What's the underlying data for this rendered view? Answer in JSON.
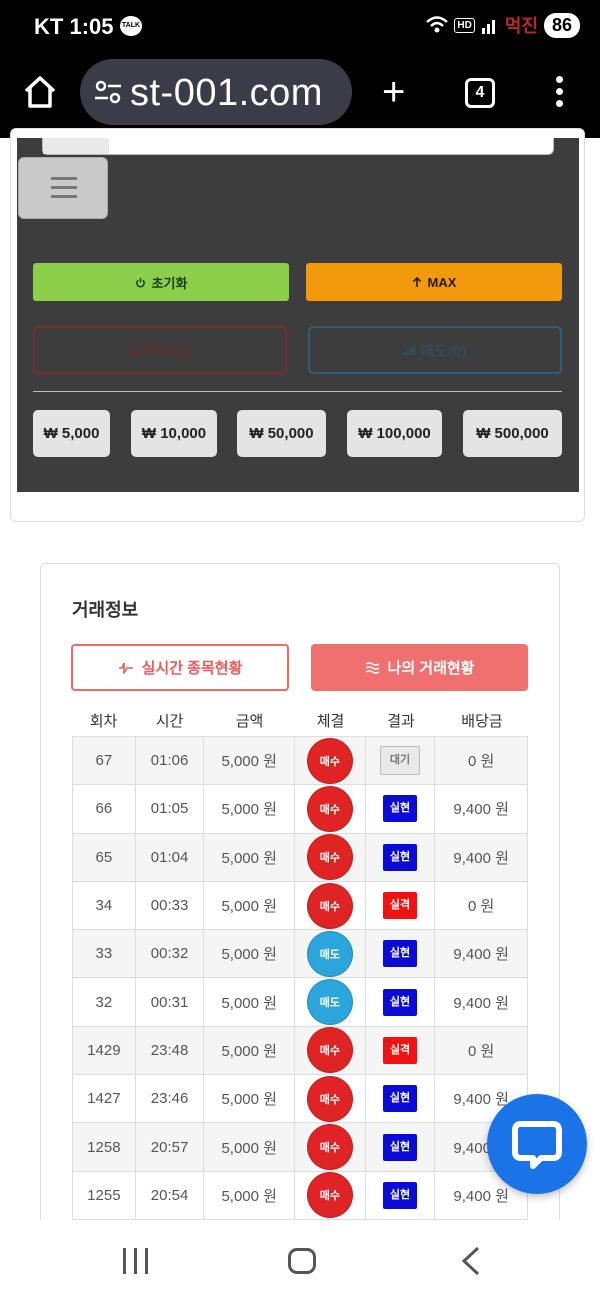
{
  "status": {
    "carrier": "KT",
    "time": "1:05",
    "talk": "TALK",
    "hd": "HD",
    "battery": "86",
    "watermark": "먹진"
  },
  "browser": {
    "url": "st-001.com",
    "tab_count": "4"
  },
  "controls": {
    "reset_label": "초기화",
    "max_label": "MAX",
    "buy_label": "매수(0)",
    "sell_label": "매도(0)",
    "amounts": [
      "₩ 5,000",
      "₩ 10,000",
      "₩ 50,000",
      "₩ 100,000",
      "₩ 500,000"
    ]
  },
  "trade_info": {
    "title": "거래정보",
    "tab_live": "실시간 종목현황",
    "tab_mine": "나의 거래현황",
    "columns": [
      "회차",
      "시간",
      "금액",
      "체결",
      "결과",
      "배당금"
    ],
    "rows": [
      {
        "round": "67",
        "time": "01:06",
        "amount": "5,000 원",
        "exec": "매수",
        "result": "대기",
        "payout": "0 원"
      },
      {
        "round": "66",
        "time": "01:05",
        "amount": "5,000 원",
        "exec": "매수",
        "result": "실현",
        "payout": "9,400 원"
      },
      {
        "round": "65",
        "time": "01:04",
        "amount": "5,000 원",
        "exec": "매수",
        "result": "실현",
        "payout": "9,400 원"
      },
      {
        "round": "34",
        "time": "00:33",
        "amount": "5,000 원",
        "exec": "매수",
        "result": "실격",
        "payout": "0 원"
      },
      {
        "round": "33",
        "time": "00:32",
        "amount": "5,000 원",
        "exec": "매도",
        "result": "실현",
        "payout": "9,400 원"
      },
      {
        "round": "32",
        "time": "00:31",
        "amount": "5,000 원",
        "exec": "매도",
        "result": "실현",
        "payout": "9,400 원"
      },
      {
        "round": "1429",
        "time": "23:48",
        "amount": "5,000 원",
        "exec": "매수",
        "result": "실격",
        "payout": "0 원"
      },
      {
        "round": "1427",
        "time": "23:46",
        "amount": "5,000 원",
        "exec": "매수",
        "result": "실현",
        "payout": "9,400 원"
      },
      {
        "round": "1258",
        "time": "20:57",
        "amount": "5,000 원",
        "exec": "매수",
        "result": "실현",
        "payout": "9,400 원"
      },
      {
        "round": "1255",
        "time": "20:54",
        "amount": "5,000 원",
        "exec": "매수",
        "result": "실현",
        "payout": "9,400 원"
      }
    ]
  },
  "colors": {
    "buy": "#e02424",
    "sell": "#2aa6dc",
    "win": "#0b0bd8",
    "lose": "#f01212",
    "reset": "#8bcf4a",
    "max": "#f29a0c",
    "accent": "#f07070"
  }
}
